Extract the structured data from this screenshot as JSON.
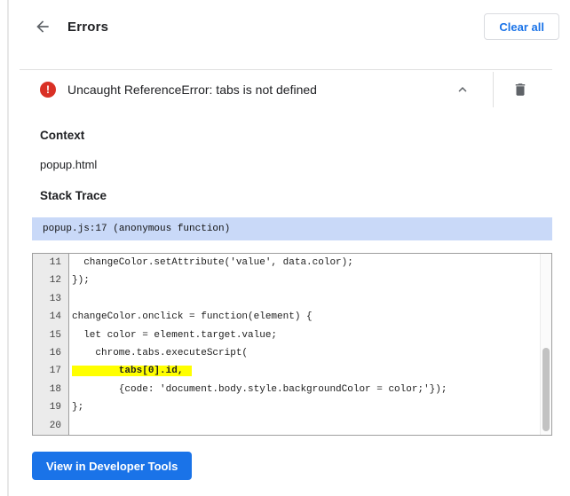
{
  "colors": {
    "accent_blue": "#1a73e8",
    "error_red": "#d93025",
    "stack_bar_bg": "#c9d9f8",
    "highlight_yellow": "#ffff00"
  },
  "header": {
    "title": "Errors",
    "clear_all_label": "Clear all"
  },
  "error_item": {
    "severity_glyph": "!",
    "message": "Uncaught ReferenceError: tabs is not defined"
  },
  "context": {
    "heading": "Context",
    "value": "popup.html"
  },
  "stack_trace": {
    "heading": "Stack Trace",
    "frame_label": "popup.js:17 (anonymous function)"
  },
  "code_viewer": {
    "highlighted_line": 17,
    "lines": [
      {
        "number": 11,
        "text": "  changeColor.setAttribute('value', data.color);"
      },
      {
        "number": 12,
        "text": "});"
      },
      {
        "number": 13,
        "text": ""
      },
      {
        "number": 14,
        "text": "changeColor.onclick = function(element) {"
      },
      {
        "number": 15,
        "text": "  let color = element.target.value;"
      },
      {
        "number": 16,
        "text": "    chrome.tabs.executeScript("
      },
      {
        "number": 17,
        "text": "        tabs[0].id,"
      },
      {
        "number": 18,
        "text": "        {code: 'document.body.style.backgroundColor = color;'});"
      },
      {
        "number": 19,
        "text": "};"
      },
      {
        "number": 20,
        "text": ""
      }
    ]
  },
  "footer": {
    "view_button_label": "View in Developer Tools"
  }
}
